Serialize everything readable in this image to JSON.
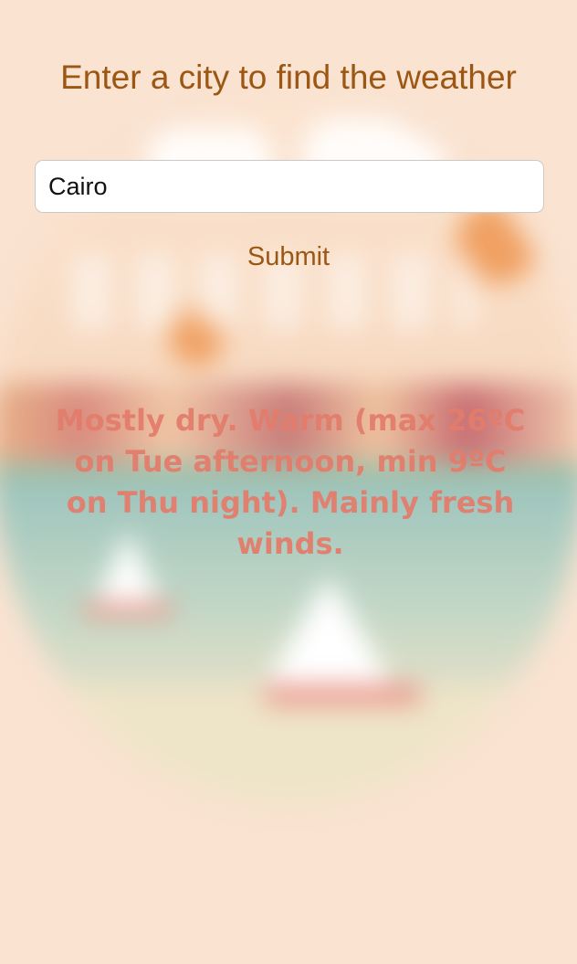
{
  "page": {
    "heading": "Enter a city to find the weather"
  },
  "search": {
    "value": "Cairo",
    "placeholder": ""
  },
  "actions": {
    "submit_label": "Submit"
  },
  "result": {
    "forecast": "Mostly dry. Warm (max 26ºC on Tue afternoon, min 9ºC on Thu night). Mainly fresh winds."
  },
  "colors": {
    "background": "#fae3d1",
    "accent_text": "#9b5713",
    "forecast_text": "#e37d6c"
  }
}
